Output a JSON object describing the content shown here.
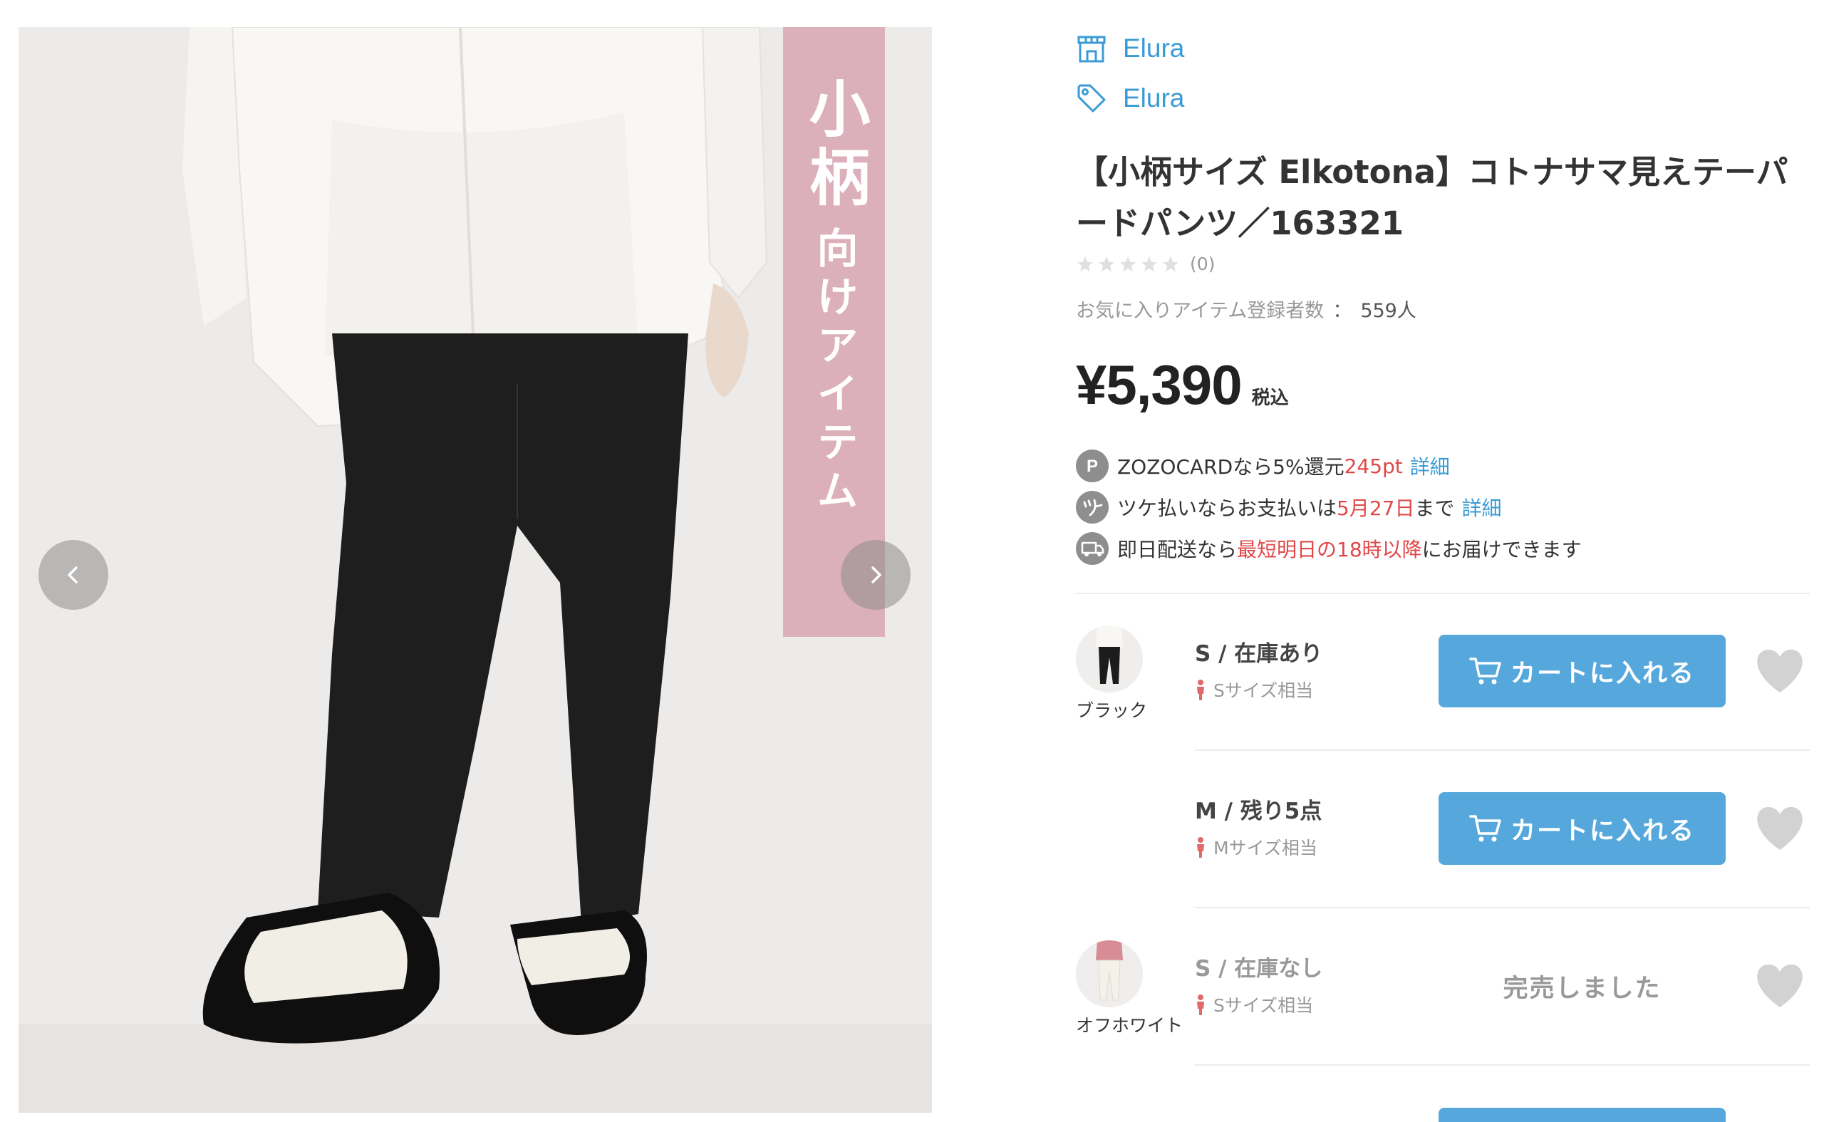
{
  "gallery": {
    "banner_big": "小柄",
    "banner_small": "向けアイテム",
    "prev_icon": "chevron-left-icon",
    "next_icon": "chevron-right-icon"
  },
  "shop": {
    "name": "Elura",
    "icon": "shop-icon"
  },
  "brand": {
    "name": "Elura",
    "icon": "tag-icon"
  },
  "product": {
    "title": "【小柄サイズ Elkotona】コトナサマ見えテーパードパンツ／163321",
    "rating_count": "(0)",
    "favorites_label": "お気に入りアイテム登録者数",
    "favorites_colon": "：",
    "favorites_value": "559人",
    "price": "¥5,390",
    "tax_label": "税込"
  },
  "promos": [
    {
      "icon": "points-icon",
      "text_before": "ZOZOCARDなら5%還元",
      "highlight": "245pt",
      "text_after": "",
      "link": "詳細"
    },
    {
      "icon": "tsuke-icon",
      "text_before": "ツケ払いならお支払いは",
      "highlight": "5月27日",
      "text_after": "まで",
      "link": "詳細"
    },
    {
      "icon": "delivery-icon",
      "text_before": "即日配送なら",
      "highlight": "最短明日の18時以降",
      "text_after": "にお届けできます",
      "link": ""
    }
  ],
  "variants": [
    {
      "color_label": "ブラック",
      "size_stock": "S / 在庫あり",
      "size_equiv": "Sサイズ相当",
      "action": "カートに入れる",
      "sold_out": false
    },
    {
      "color_label": "",
      "size_stock": "M / 残り5点",
      "size_equiv": "Mサイズ相当",
      "action": "カートに入れる",
      "sold_out": false
    },
    {
      "color_label": "オフホワイト",
      "size_stock": "S / 在庫なし",
      "size_equiv": "Sサイズ相当",
      "action": "完売しました",
      "sold_out": true
    }
  ],
  "colors": {
    "accent_blue": "#3a9bd5",
    "button_blue": "#56a8dc",
    "highlight_red": "#e04848",
    "banner_pink": "#dcb0bb"
  }
}
